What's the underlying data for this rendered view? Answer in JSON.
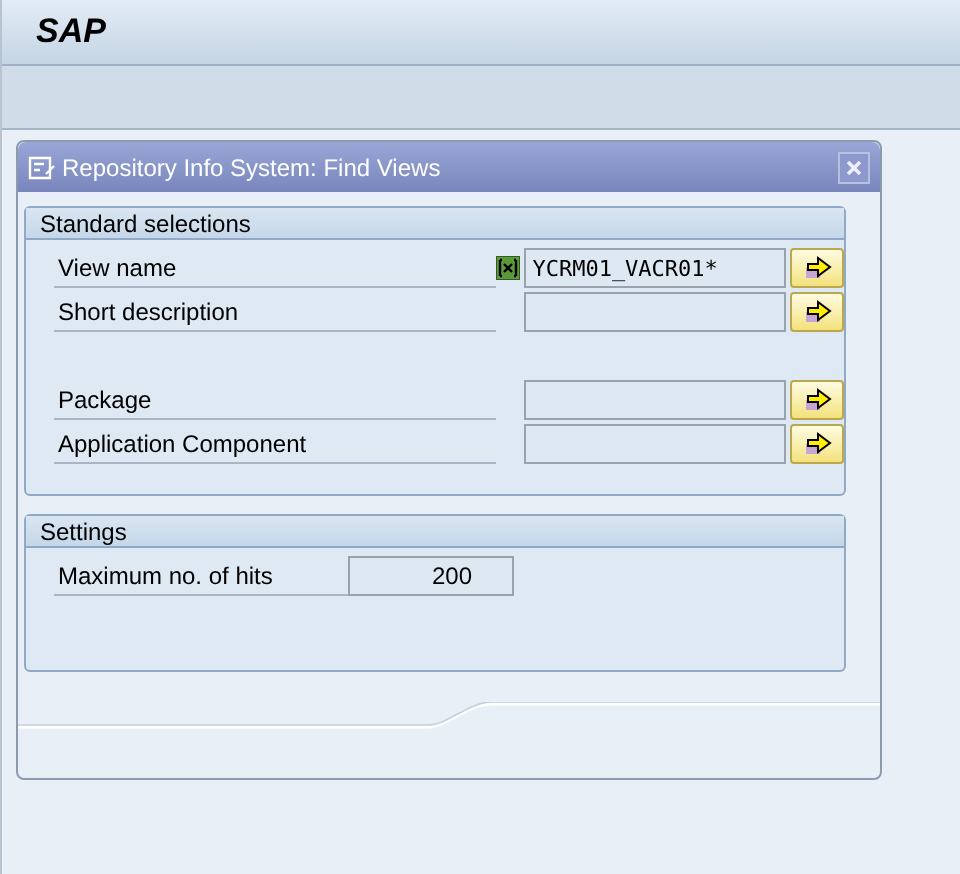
{
  "app": {
    "title": "SAP"
  },
  "dialog": {
    "title": "Repository Info System: Find Views",
    "groups": [
      {
        "title": "Standard selections",
        "field_sets": [
          [
            {
              "label": "View name",
              "value": "YCRM01_VACR01*",
              "selection_active": true
            },
            {
              "label": "Short description",
              "selection_active": false
            }
          ],
          [
            {
              "label": "Package",
              "selection_active": false
            },
            {
              "label": "Application Component",
              "selection_active": false
            }
          ]
        ]
      },
      {
        "title": "Settings",
        "field_sets": [
          [
            {
              "label": "Maximum no. of hits",
              "value": "200",
              "kind": "number"
            }
          ]
        ]
      }
    ]
  }
}
